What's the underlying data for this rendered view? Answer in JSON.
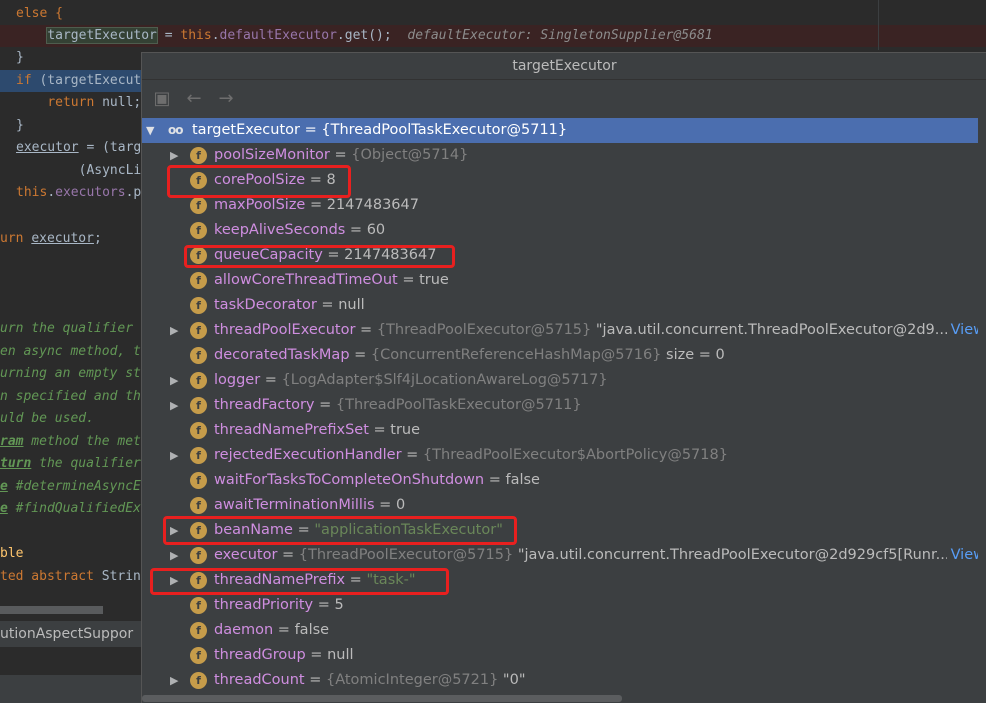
{
  "editor": {
    "lines": [
      {
        "segments": [
          {
            "t": "else {",
            "c": "kw"
          }
        ]
      },
      {
        "segments": [
          {
            "t": "    "
          },
          {
            "t": "targetExecutor",
            "c": "sel-word"
          },
          {
            "t": " = "
          },
          {
            "t": "this",
            "c": "kw"
          },
          {
            "t": "."
          },
          {
            "t": "defaultExecutor",
            "c": "fld"
          },
          {
            "t": ".get();  "
          },
          {
            "t": "defaultExecutor: SingletonSupplier@5681",
            "c": "inlay"
          }
        ]
      },
      {
        "segments": [
          {
            "t": "}"
          }
        ]
      },
      {
        "segments": [
          {
            "t": "if",
            "c": "kw"
          },
          {
            "t": " (targetExecut"
          }
        ]
      },
      {
        "segments": [
          {
            "t": "    "
          },
          {
            "t": "return",
            "c": "kw"
          },
          {
            "t": " null;"
          }
        ]
      },
      {
        "segments": [
          {
            "t": "}"
          }
        ]
      },
      {
        "segments": [
          {
            "t": "executor",
            "c": "ul"
          },
          {
            "t": " = (targ"
          }
        ]
      },
      {
        "segments": [
          {
            "t": "        (AsyncLi"
          }
        ]
      },
      {
        "segments": [
          {
            "t": "this",
            "c": "kw"
          },
          {
            "t": "."
          },
          {
            "t": "executors",
            "c": "fld"
          },
          {
            "t": ".p"
          }
        ]
      },
      {
        "segments": [
          {
            "t": ""
          }
        ]
      },
      {
        "segments": [
          {
            "t": "urn ",
            "c": "kw"
          },
          {
            "t": "executor",
            "c": "ul"
          },
          {
            "t": ";"
          }
        ]
      },
      {
        "segments": [
          {
            "t": ""
          }
        ]
      },
      {
        "segments": [
          {
            "t": ""
          }
        ]
      },
      {
        "segments": [
          {
            "t": "urn the qualifier",
            "c": "cm"
          }
        ]
      },
      {
        "segments": [
          {
            "t": "en async method, t",
            "c": "cm"
          }
        ]
      },
      {
        "segments": [
          {
            "t": "urning an empty st",
            "c": "cm"
          }
        ]
      },
      {
        "segments": [
          {
            "t": "n specified and th",
            "c": "cm"
          }
        ]
      },
      {
        "segments": [
          {
            "t": "uld be used.",
            "c": "cm"
          }
        ]
      },
      {
        "segments": [
          {
            "t": "ram",
            "c": "cm-tag"
          },
          {
            "t": " method the met",
            "c": "cm"
          }
        ]
      },
      {
        "segments": [
          {
            "t": "turn",
            "c": "cm-tag"
          },
          {
            "t": " the qualifier",
            "c": "cm"
          }
        ]
      },
      {
        "segments": [
          {
            "t": "e",
            "c": "cm-tag"
          },
          {
            "t": " #determineAsyncE",
            "c": "cm"
          }
        ]
      },
      {
        "segments": [
          {
            "t": "e",
            "c": "cm-tag"
          },
          {
            "t": " #findQualifiedEx",
            "c": "cm"
          }
        ]
      },
      {
        "segments": [
          {
            "t": ""
          }
        ]
      },
      {
        "segments": [
          {
            "t": "ble",
            "c": "fn"
          }
        ]
      },
      {
        "segments": [
          {
            "t": "ted abstract ",
            "c": "kw"
          },
          {
            "t": "Strin"
          }
        ]
      }
    ],
    "breadcrumb": "utionAspectSuppor"
  },
  "popup": {
    "title": "targetExecutor",
    "root": {
      "name": "targetExecutor",
      "value": "{ThreadPoolTaskExecutor@5711}"
    },
    "fields": [
      {
        "name": "poolSizeMonitor",
        "value": "{Object@5714}",
        "vtype": "ref",
        "expandable": true
      },
      {
        "name": "corePoolSize",
        "value": "8",
        "vtype": "num",
        "expandable": false
      },
      {
        "name": "maxPoolSize",
        "value": "2147483647",
        "vtype": "num",
        "expandable": false
      },
      {
        "name": "keepAliveSeconds",
        "value": "60",
        "vtype": "num",
        "expandable": false
      },
      {
        "name": "queueCapacity",
        "value": "2147483647",
        "vtype": "num",
        "expandable": false
      },
      {
        "name": "allowCoreThreadTimeOut",
        "value": "true",
        "vtype": "kw",
        "expandable": false
      },
      {
        "name": "taskDecorator",
        "value": "null",
        "vtype": "kw",
        "expandable": false
      },
      {
        "name": "threadPoolExecutor",
        "value": "{ThreadPoolExecutor@5715}",
        "vtype": "ref",
        "extra": " \"java.util.concurrent.ThreadPoolExecutor@2d9...",
        "view": "View",
        "expandable": true
      },
      {
        "name": "decoratedTaskMap",
        "value": "{ConcurrentReferenceHashMap@5716}",
        "vtype": "ref",
        "extra": "  size = 0",
        "expandable": false
      },
      {
        "name": "logger",
        "value": "{LogAdapter$Slf4jLocationAwareLog@5717}",
        "vtype": "ref",
        "expandable": true
      },
      {
        "name": "threadFactory",
        "value": "{ThreadPoolTaskExecutor@5711}",
        "vtype": "ref",
        "expandable": true
      },
      {
        "name": "threadNamePrefixSet",
        "value": "true",
        "vtype": "kw",
        "expandable": false
      },
      {
        "name": "rejectedExecutionHandler",
        "value": "{ThreadPoolExecutor$AbortPolicy@5718}",
        "vtype": "ref",
        "expandable": true
      },
      {
        "name": "waitForTasksToCompleteOnShutdown",
        "value": "false",
        "vtype": "kw",
        "expandable": false
      },
      {
        "name": "awaitTerminationMillis",
        "value": "0",
        "vtype": "num",
        "expandable": false
      },
      {
        "name": "beanName",
        "value": "\"applicationTaskExecutor\"",
        "vtype": "str",
        "expandable": true
      },
      {
        "name": "executor",
        "value": "{ThreadPoolExecutor@5715}",
        "vtype": "ref",
        "extra": " \"java.util.concurrent.ThreadPoolExecutor@2d929cf5[Runr...",
        "view": "View",
        "expandable": true
      },
      {
        "name": "threadNamePrefix",
        "value": "\"task-\"",
        "vtype": "str",
        "expandable": true
      },
      {
        "name": "threadPriority",
        "value": "5",
        "vtype": "num",
        "expandable": false
      },
      {
        "name": "daemon",
        "value": "false",
        "vtype": "kw",
        "expandable": false
      },
      {
        "name": "threadGroup",
        "value": "null",
        "vtype": "kw",
        "expandable": false
      },
      {
        "name": "threadCount",
        "value": "{AtomicInteger@5721}",
        "vtype": "ref",
        "extra": " \"0\"",
        "expandable": true
      }
    ]
  },
  "icons": {
    "field_badge": "f",
    "watch": "oo",
    "expand": "▶",
    "collapse": "▼",
    "back": "←",
    "forward": "→",
    "tree_toggle": "▣"
  },
  "colors": {
    "highlight_box": "#e8201f",
    "selection": "#4b6eaf",
    "field_name": "#cf8ee0",
    "string_value": "#6a8759"
  }
}
